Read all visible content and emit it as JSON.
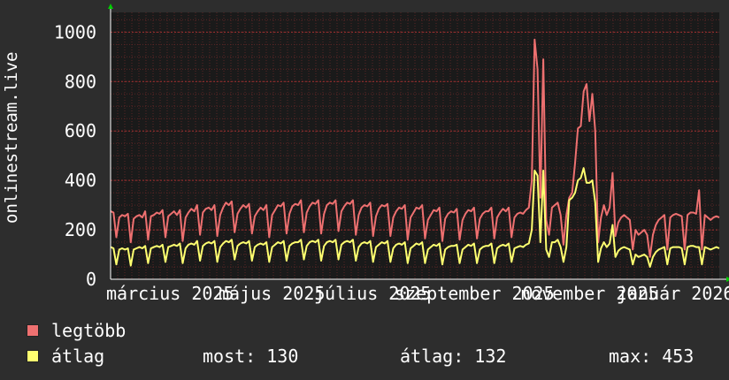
{
  "chart_data": {
    "type": "line",
    "ylabel": "onlinestream.live",
    "ylim": [
      0,
      1080
    ],
    "yticks": [
      0,
      200,
      400,
      600,
      800,
      1000
    ],
    "xticks": [
      "március 2025",
      "május 2025",
      "július 2025",
      "szeptember 2025",
      "november 2025",
      "január 2026"
    ],
    "colors": {
      "background": "#2d2d2d",
      "plot": "#1a1a1a",
      "grid": "#6a2828",
      "axis": "#00cc00",
      "max": "#ee7070",
      "avg": "#ffff70"
    },
    "series": [
      {
        "name": "legtöbb",
        "color": "#ee7070",
        "values": [
          275,
          270,
          170,
          250,
          260,
          255,
          265,
          150,
          245,
          255,
          260,
          250,
          275,
          160,
          255,
          260,
          270,
          265,
          280,
          170,
          255,
          265,
          275,
          260,
          280,
          155,
          250,
          270,
          285,
          275,
          300,
          180,
          270,
          285,
          290,
          280,
          300,
          175,
          260,
          290,
          310,
          300,
          315,
          190,
          265,
          285,
          300,
          290,
          305,
          185,
          255,
          275,
          290,
          280,
          300,
          170,
          260,
          280,
          300,
          295,
          310,
          185,
          265,
          295,
          305,
          300,
          320,
          190,
          270,
          295,
          310,
          305,
          320,
          185,
          265,
          300,
          310,
          305,
          320,
          195,
          275,
          295,
          310,
          305,
          320,
          180,
          260,
          290,
          300,
          295,
          310,
          175,
          255,
          285,
          300,
          295,
          305,
          175,
          250,
          275,
          290,
          285,
          300,
          160,
          250,
          270,
          290,
          285,
          300,
          165,
          240,
          260,
          280,
          275,
          290,
          155,
          245,
          265,
          275,
          270,
          285,
          160,
          240,
          265,
          280,
          275,
          290,
          165,
          245,
          265,
          275,
          275,
          290,
          165,
          250,
          270,
          285,
          275,
          290,
          170,
          250,
          265,
          270,
          265,
          280,
          290,
          400,
          970,
          850,
          330,
          890,
          240,
          180,
          290,
          300,
          310,
          260,
          140,
          260,
          330,
          350,
          470,
          610,
          620,
          760,
          790,
          640,
          750,
          600,
          150,
          250,
          300,
          260,
          290,
          430,
          175,
          230,
          250,
          260,
          250,
          240,
          120,
          200,
          180,
          190,
          200,
          180,
          90,
          180,
          220,
          240,
          250,
          260,
          120,
          250,
          260,
          265,
          260,
          255,
          120,
          260,
          270,
          270,
          265,
          360,
          120,
          260,
          250,
          240,
          250,
          255,
          250
        ]
      },
      {
        "name": "átlag",
        "color": "#ffff70",
        "values": [
          130,
          125,
          60,
          120,
          125,
          120,
          125,
          55,
          120,
          125,
          130,
          125,
          135,
          65,
          125,
          130,
          135,
          130,
          140,
          70,
          130,
          135,
          140,
          135,
          145,
          65,
          125,
          140,
          145,
          140,
          155,
          75,
          135,
          145,
          150,
          145,
          155,
          70,
          130,
          145,
          155,
          150,
          160,
          80,
          135,
          145,
          150,
          145,
          155,
          75,
          130,
          140,
          145,
          140,
          150,
          70,
          130,
          140,
          150,
          145,
          155,
          75,
          135,
          145,
          150,
          150,
          160,
          80,
          135,
          150,
          155,
          150,
          160,
          75,
          135,
          150,
          155,
          150,
          160,
          80,
          140,
          150,
          155,
          150,
          160,
          75,
          130,
          145,
          150,
          145,
          155,
          70,
          130,
          140,
          150,
          145,
          155,
          70,
          125,
          140,
          145,
          140,
          150,
          65,
          125,
          135,
          145,
          140,
          150,
          65,
          120,
          130,
          140,
          135,
          145,
          60,
          120,
          130,
          135,
          135,
          140,
          65,
          120,
          130,
          140,
          135,
          145,
          65,
          120,
          130,
          135,
          135,
          145,
          65,
          125,
          135,
          140,
          135,
          145,
          70,
          125,
          130,
          135,
          130,
          140,
          145,
          200,
          440,
          420,
          150,
          440,
          120,
          90,
          150,
          150,
          160,
          130,
          70,
          130,
          320,
          330,
          350,
          400,
          410,
          450,
          390,
          390,
          400,
          310,
          70,
          125,
          150,
          130,
          145,
          220,
          90,
          115,
          125,
          130,
          125,
          120,
          60,
          100,
          90,
          95,
          100,
          90,
          50,
          90,
          110,
          120,
          125,
          130,
          60,
          125,
          130,
          130,
          130,
          125,
          60,
          130,
          135,
          135,
          130,
          130,
          60,
          130,
          125,
          120,
          125,
          130,
          125
        ]
      }
    ]
  },
  "legend": {
    "max_label": "legtöbb",
    "avg_label": "átlag",
    "now_label": "most:",
    "now_value": "130",
    "avg_stat_label": "átlag:",
    "avg_stat_value": "132",
    "max_stat_label": "max:",
    "max_stat_value": "453"
  }
}
